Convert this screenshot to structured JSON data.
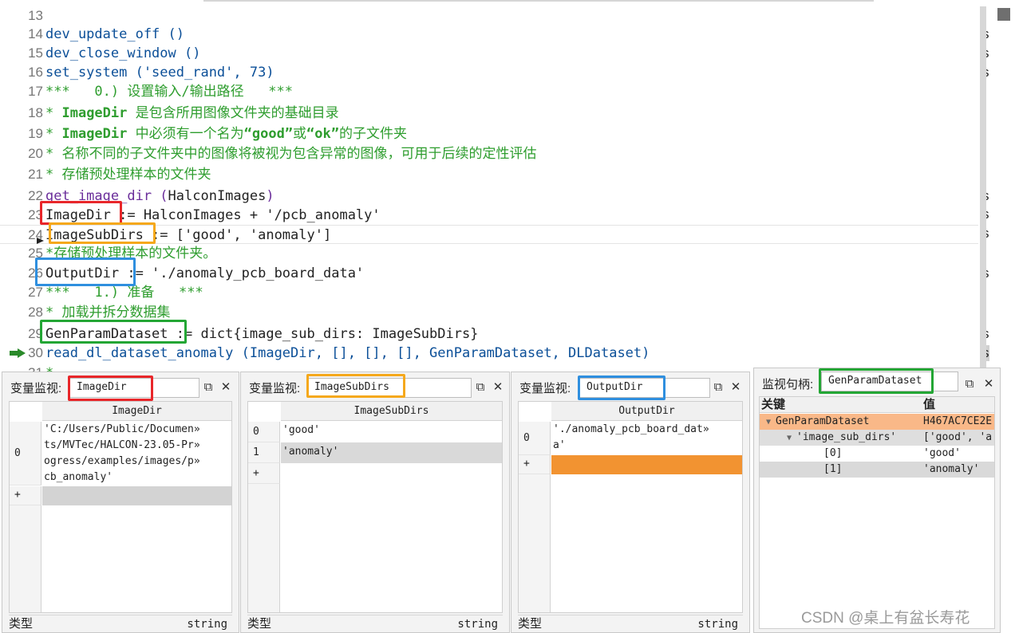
{
  "editor": {
    "lines": [
      {
        "n": "13",
        "parts": []
      },
      {
        "n": "14",
        "parts": [
          {
            "t": "dev_update_off ()",
            "c": "c-op"
          }
        ]
      },
      {
        "n": "15",
        "parts": [
          {
            "t": "dev_close_window ()",
            "c": "c-op"
          }
        ]
      },
      {
        "n": "16",
        "parts": [
          {
            "t": "set_system ('seed_rand', 73)",
            "c": "c-op"
          }
        ]
      },
      {
        "n": "17",
        "parts": [
          {
            "t": "***   0.) 设置输入/输出路径   ***",
            "c": "c-comment"
          }
        ]
      },
      {
        "n": "18",
        "parts": [
          {
            "t": "* ",
            "c": "c-comment"
          },
          {
            "t": "ImageDir",
            "c": "c-hl"
          },
          {
            "t": " 是包含所用图像文件夹的基础目录",
            "c": "c-comment"
          }
        ]
      },
      {
        "n": "19",
        "parts": [
          {
            "t": "* ",
            "c": "c-comment"
          },
          {
            "t": "ImageDir",
            "c": "c-hl"
          },
          {
            "t": " 中必须有一个名为",
            "c": "c-comment"
          },
          {
            "t": "“good”",
            "c": "c-hl"
          },
          {
            "t": "或",
            "c": "c-comment"
          },
          {
            "t": "“ok”",
            "c": "c-hl"
          },
          {
            "t": "的子文件夹",
            "c": "c-comment"
          }
        ]
      },
      {
        "n": "20",
        "parts": [
          {
            "t": "* 名称不同的子文件夹中的图像将被视为包含异常的图像，可用于后续的定性评估",
            "c": "c-comment"
          }
        ]
      },
      {
        "n": "21",
        "parts": [
          {
            "t": "* 存储预处理样本的文件夹",
            "c": "c-comment"
          }
        ]
      },
      {
        "n": "22",
        "parts": [
          {
            "t": "get_image_dir (",
            "c": "c-proc"
          },
          {
            "t": "HalconImages",
            "c": "c-var"
          },
          {
            "t": ")",
            "c": "c-proc"
          }
        ]
      },
      {
        "n": "23",
        "parts": [
          {
            "t": "ImageDir := HalconImages + '/pcb_anomaly'",
            "c": "c-plain"
          }
        ]
      },
      {
        "n": "24",
        "parts": [
          {
            "t": "ImageSubDirs := ['good', 'anomaly']",
            "c": "c-plain"
          }
        ]
      },
      {
        "n": "25",
        "parts": [
          {
            "t": "*存储预处理样本的文件夹。",
            "c": "c-comment"
          }
        ]
      },
      {
        "n": "26",
        "parts": [
          {
            "t": "OutputDir := './anomaly_pcb_board_data'",
            "c": "c-plain"
          }
        ]
      },
      {
        "n": "27",
        "parts": [
          {
            "t": "***   1.) 准备   ***",
            "c": "c-comment"
          }
        ]
      },
      {
        "n": "28",
        "parts": [
          {
            "t": "* 加载并拆分数据集",
            "c": "c-comment"
          }
        ]
      },
      {
        "n": "29",
        "parts": [
          {
            "t": "GenParamDataset := dict{image_sub_dirs: ImageSubDirs}",
            "c": "c-plain"
          }
        ]
      },
      {
        "n": "30",
        "parts": [
          {
            "t": "read_dl_dataset_anomaly (ImageDir, [], [], [], GenParamDataset, DLDataset)",
            "c": "c-op"
          }
        ]
      },
      {
        "n": "31",
        "parts": [
          {
            "t": "*",
            "c": "c-comment"
          }
        ]
      }
    ],
    "right_cut_text": "s",
    "annotation_colors": {
      "ImageDir": "#e8262a",
      "ImageSubDirs": "#f5a81c",
      "OutputDir": "#2f8fdf",
      "GenParamDataset": "#23a634"
    }
  },
  "watch_panes": [
    {
      "title": "变量监视:",
      "var": "ImageDir",
      "column": "ImageDir",
      "rows": [
        {
          "idx": "0",
          "lines": [
            "'C:/Users/Public/Documen»",
            "ts/MVTec/HALCON-23.05-Pr»",
            "ogress/examples/images/p»",
            "cb_anomaly'"
          ]
        },
        {
          "idx": "+",
          "lines": [
            ""
          ]
        }
      ],
      "type_label": "类型",
      "type_value": "string"
    },
    {
      "title": "变量监视:",
      "var": "ImageSubDirs",
      "column": "ImageSubDirs",
      "rows": [
        {
          "idx": "0",
          "lines": [
            "'good'"
          ]
        },
        {
          "idx": "1",
          "lines": [
            "'anomaly'"
          ]
        },
        {
          "idx": "+",
          "lines": [
            ""
          ]
        }
      ],
      "type_label": "类型",
      "type_value": "string"
    },
    {
      "title": "变量监视:",
      "var": "OutputDir",
      "column": "OutputDir",
      "rows": [
        {
          "idx": "0",
          "lines": [
            "'./anomaly_pcb_board_dat»",
            "a'"
          ]
        },
        {
          "idx": "+",
          "lines": [
            ""
          ]
        }
      ],
      "type_label": "类型",
      "type_value": "string"
    }
  ],
  "handle_pane": {
    "title": "监视句柄:",
    "var": "GenParamDataset",
    "key_header": "关键",
    "value_header": "值",
    "rows": [
      {
        "key": "GenParamDataset",
        "value": "H467AC7CE2E"
      },
      {
        "key": "'image_sub_dirs'",
        "value": "['good', 'a"
      },
      {
        "key": "[0]",
        "value": "'good'"
      },
      {
        "key": "[1]",
        "value": "'anomaly'"
      }
    ]
  },
  "colors": {
    "selected_orange": "#f29331",
    "tree_highlight": "#f9b888"
  },
  "watermark": "CSDN @桌上有盆长寿花"
}
